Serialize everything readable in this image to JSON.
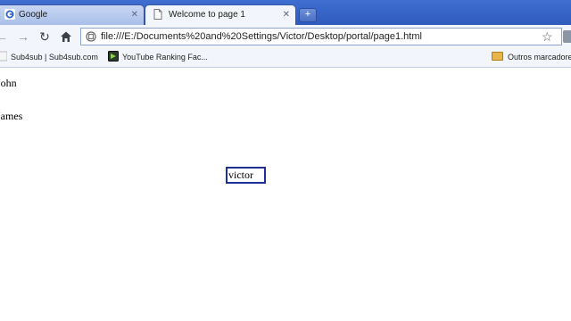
{
  "tabs": [
    {
      "label": "Google",
      "active": false
    },
    {
      "label": "Welcome to page 1",
      "active": true
    }
  ],
  "toolbar": {
    "url": "file:///E:/Documents%20and%20Settings/Victor/Desktop/portal/page1.html"
  },
  "bookmarks": {
    "items": [
      {
        "label": "Sub4sub | Sub4sub.com"
      },
      {
        "label": "YouTube Ranking Fac..."
      }
    ],
    "other_label": "Outros marcadores"
  },
  "page": {
    "lines": [
      "John",
      "James"
    ],
    "input_value": "victor"
  },
  "colors": {
    "tabstrip": "#3f6ed0",
    "toolbar": "#f2f5fb",
    "textbox_border": "#1f2f98"
  }
}
